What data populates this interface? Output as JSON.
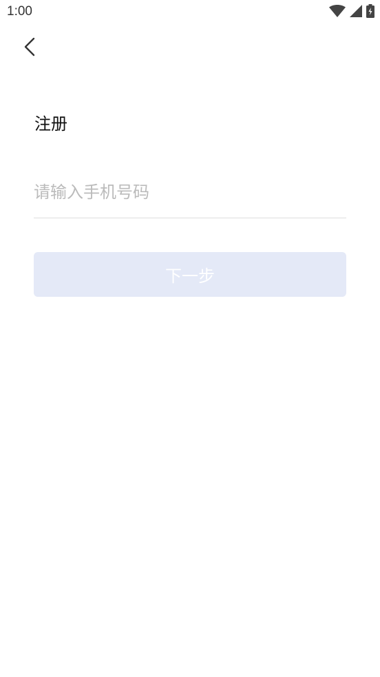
{
  "status_bar": {
    "time": "1:00",
    "icons": [
      "wifi-icon",
      "cellular-signal-icon",
      "battery-charging-icon"
    ]
  },
  "header": {
    "back_icon": "chevron-left-icon"
  },
  "main": {
    "title": "注册",
    "phone_input": {
      "value": "",
      "placeholder": "请输入手机号码"
    },
    "next_button_label": "下一步"
  },
  "colors": {
    "button_disabled_bg": "#e4e9f7",
    "placeholder": "#bbbbbb",
    "divider": "#dddddd",
    "title": "#111111"
  }
}
